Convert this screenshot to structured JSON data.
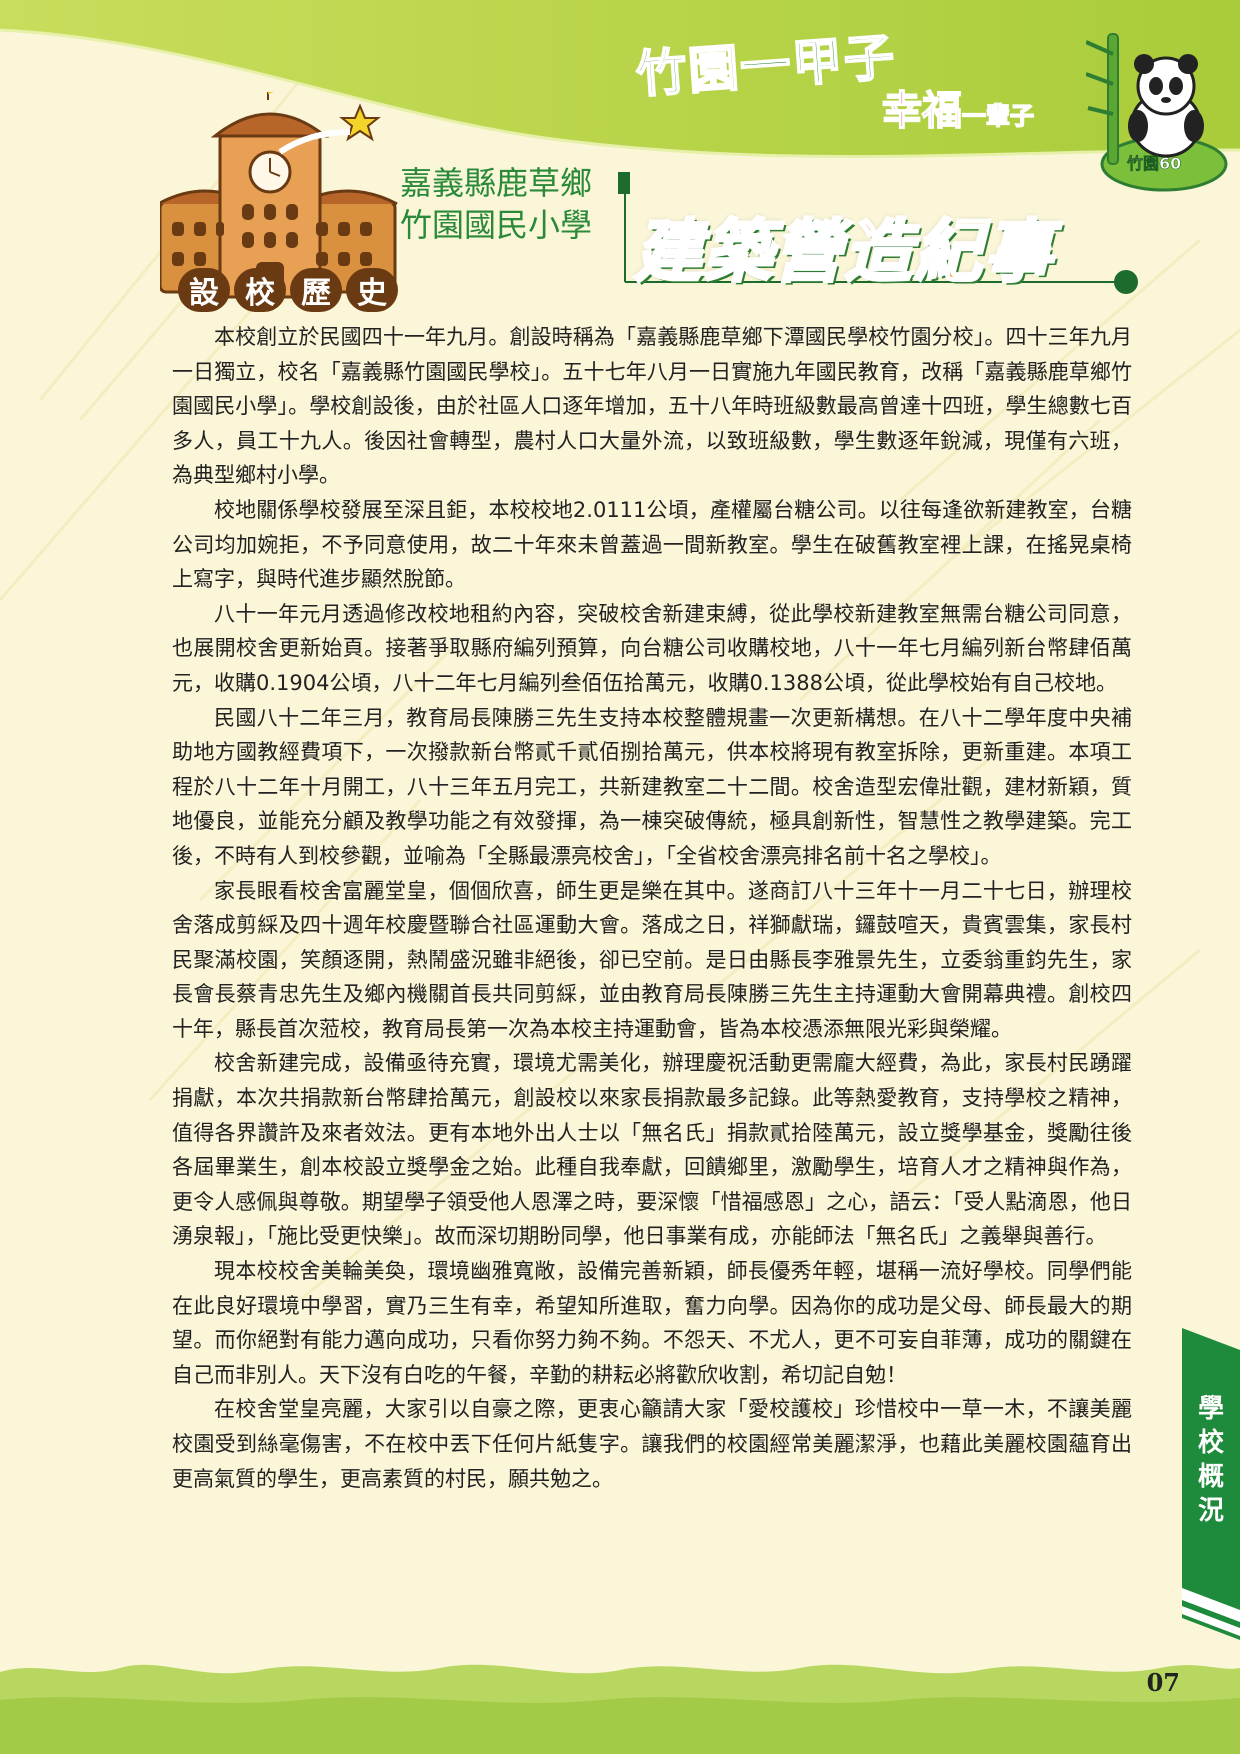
{
  "header": {
    "slogan_main": "竹園一甲子",
    "slogan_sub": "幸福",
    "slogan_sub_small": "一輩子",
    "logo_text": "竹園60",
    "county_line": "嘉義縣鹿草鄉",
    "school_line": "竹園國民小學",
    "title": "建築營造紀事",
    "badge_chars": [
      "設",
      "校",
      "歷",
      "史"
    ]
  },
  "body": {
    "paragraphs": [
      "本校創立於民國四十一年九月。創設時稱為「嘉義縣鹿草鄉下潭國民學校竹園分校」。四十三年九月一日獨立，校名「嘉義縣竹園國民學校」。五十七年八月一日實施九年國民教育，改稱「嘉義縣鹿草鄉竹園國民小學」。學校創設後，由於社區人口逐年增加，五十八年時班級數最高曾達十四班，學生總數七百多人，員工十九人。後因社會轉型，農村人口大量外流，以致班級數，學生數逐年銳減，現僅有六班，為典型鄉村小學。",
      "校地關係學校發展至深且鉅，本校校地2.0111公頃，產權屬台糖公司。以往每逢欲新建教室，台糖公司均加婉拒，不予同意使用，故二十年來未曾蓋過一間新教室。學生在破舊教室裡上課，在搖晃桌椅上寫字，與時代進步顯然脫節。",
      "八十一年元月透過修改校地租約內容，突破校舍新建束縛，從此學校新建教室無需台糖公司同意，也展開校舍更新始頁。接著爭取縣府編列預算，向台糖公司收購校地，八十一年七月編列新台幣肆佰萬元，收購0.1904公頃，八十二年七月編列叁佰伍拾萬元，收購0.1388公頃，從此學校始有自己校地。",
      "民國八十二年三月，教育局長陳勝三先生支持本校整體規畫一次更新構想。在八十二學年度中央補助地方國教經費項下，一次撥款新台幣貳千貳佰捌拾萬元，供本校將現有教室拆除，更新重建。本項工程於八十二年十月開工，八十三年五月完工，共新建教室二十二間。校舍造型宏偉壯觀，建材新穎，質地優良，並能充分顧及教學功能之有效發揮，為一棟突破傳統，極具創新性，智慧性之教學建築。完工後，不時有人到校參觀，並喻為「全縣最漂亮校舍」，「全省校舍漂亮排名前十名之學校」。",
      "家長眼看校舍富麗堂皇，個個欣喜，師生更是樂在其中。遂商訂八十三年十一月二十七日，辦理校舍落成剪綵及四十週年校慶暨聯合社區運動大會。落成之日，祥獅獻瑞，鑼鼓喧天，貴賓雲集，家長村民聚滿校園，笑顏逐開，熱鬧盛況雖非絕後，卻已空前。是日由縣長李雅景先生，立委翁重鈞先生，家長會長蔡青忠先生及鄉內機關首長共同剪綵，並由教育局長陳勝三先生主持運動大會開幕典禮。創校四十年，縣長首次蒞校，教育局長第一次為本校主持運動會，皆為本校憑添無限光彩與榮耀。",
      "校舍新建完成，設備亟待充實，環境尤需美化，辦理慶祝活動更需龐大經費，為此，家長村民踴躍捐獻，本次共捐款新台幣肆拾萬元，創設校以來家長捐款最多記錄。此等熱愛教育，支持學校之精神，值得各界讚許及來者效法。更有本地外出人士以「無名氏」捐款貳拾陸萬元，設立獎學基金，獎勵往後各屆畢業生，創本校設立獎學金之始。此種自我奉獻，回饋鄉里，激勵學生，培育人才之精神與作為，更令人感佩與尊敬。期望學子領受他人恩澤之時，要深懷「惜福感恩」之心，語云：「受人點滴恩，他日湧泉報」，「施比受更快樂」。故而深切期盼同學，他日事業有成，亦能師法「無名氏」之義舉與善行。",
      "現本校校舍美輪美奐，環境幽雅寬敞，設備完善新穎，師長優秀年輕，堪稱一流好學校。同學們能在此良好環境中學習，實乃三生有幸，希望知所進取，奮力向學。因為你的成功是父母、師長最大的期望。而你絕對有能力邁向成功，只看你努力夠不夠。不怨天、不尤人，更不可妄自菲薄，成功的關鍵在自己而非別人。天下沒有白吃的午餐，辛勤的耕耘必將歡欣收割，希切記自勉！",
      "在校舍堂皇亮麗，大家引以自豪之際，更衷心籲請大家「愛校護校」珍惜校中一草一木，不讓美麗校園受到絲毫傷害，不在校中丟下任何片紙隻字。讓我們的校園經常美麗潔淨，也藉此美麗校園蘊育出更高氣質的學生，更高素質的村民，願共勉之。"
    ]
  },
  "side_tab": {
    "label": "學校概況"
  },
  "footer": {
    "page_number": "07"
  },
  "colors": {
    "accent_green": "#2a8a3a",
    "title_orange": "#f07a10",
    "tab_green": "#1e8a3c"
  }
}
